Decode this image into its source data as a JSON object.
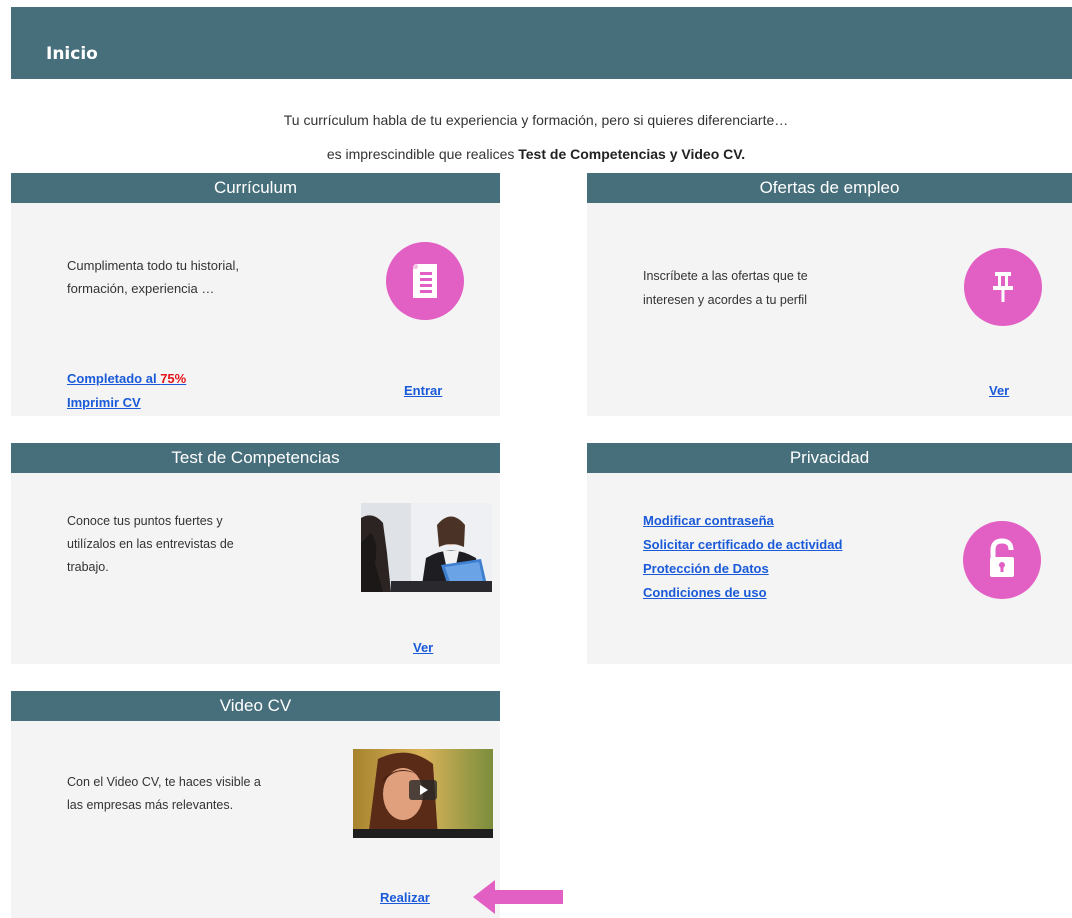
{
  "header": {
    "title": "Inicio"
  },
  "intro": {
    "line1": "Tu currículum habla de tu experiencia y formación, pero si quieres diferenciarte…",
    "line2_prefix": "es imprescindible que realices ",
    "line2_bold": "Test de Competencias y Video CV."
  },
  "cards": {
    "curriculum": {
      "title": "Currículum",
      "text_line1": "Cumplimenta todo tu historial,",
      "text_line2": "formación, experiencia …",
      "completed_label": "Completado al ",
      "completed_value": "75%",
      "print_label": "Imprimir CV",
      "enter_label": "Entrar",
      "icon": "document-icon"
    },
    "ofertas": {
      "title": "Ofertas de empleo",
      "text_line1": "Inscríbete a las ofertas que te",
      "text_line2": "interesen y acordes a tu perfil",
      "view_label": "Ver",
      "icon": "pushpin-icon"
    },
    "test": {
      "title": "Test de Competencias",
      "text_line1": "Conoce tus puntos fuertes y",
      "text_line2": "utilízalos en las entrevistas de",
      "text_line3": "trabajo.",
      "view_label": "Ver"
    },
    "privacidad": {
      "title": "Privacidad",
      "links": [
        "Modificar contraseña",
        "Solicitar certificado de actividad",
        "Protección de Datos",
        "Condiciones de uso"
      ],
      "icon": "unlock-icon"
    },
    "video": {
      "title": "Video CV",
      "text_line1": "Con el Video CV, te haces visible a",
      "text_line2": "las empresas más relevantes.",
      "action_label": "Realizar"
    }
  },
  "colors": {
    "header_bg": "#476f7b",
    "accent_pink": "#e25fc4",
    "link_blue": "#1a5ad8",
    "highlight_red": "#e4141b"
  }
}
